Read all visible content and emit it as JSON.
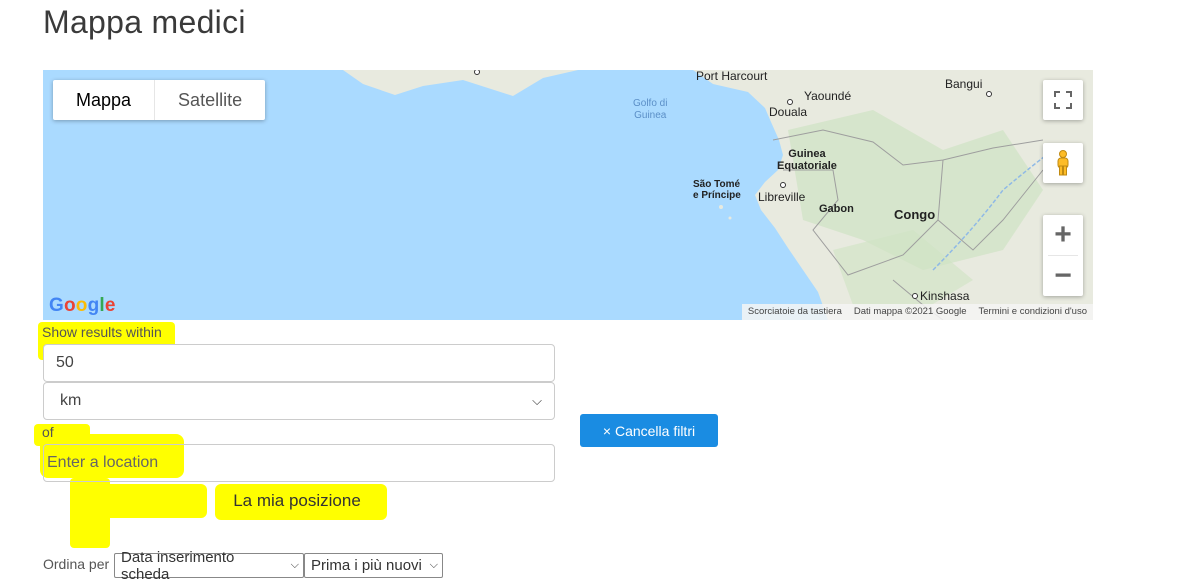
{
  "page": {
    "title": "Mappa medici"
  },
  "map": {
    "type_buttons": {
      "map": "Mappa",
      "satellite": "Satellite"
    },
    "labels": {
      "port_harcourt": "Port Harcourt",
      "yaounde": "Yaoundé",
      "bangui": "Bangui",
      "douala": "Douala",
      "golfo_1": "Golfo di",
      "golfo_2": "Guinea",
      "guinea_eq_1": "Guinea",
      "guinea_eq_2": "Equatoriale",
      "sao_tome_1": "São Tomé",
      "sao_tome_2": "e Príncipe",
      "libreville": "Libreville",
      "gabon": "Gabon",
      "congo": "Congo",
      "kinshasa": "Kinshasa"
    },
    "zoom_in": "+",
    "zoom_out": "−",
    "google_logo": "Google",
    "attribution": {
      "shortcuts": "Scorciatoie da tastiera",
      "data": "Dati mappa ©2021 Google",
      "terms": "Termini e condizioni d'uso"
    },
    "icons": {
      "fullscreen": "fullscreen-icon",
      "pegman": "pegman-icon"
    },
    "colors": {
      "water": "#aadaff",
      "land": "#e8eadf"
    }
  },
  "filters": {
    "within_label": "Show results within",
    "distance_value": "50",
    "unit_value": "km",
    "of_label": "of",
    "location_placeholder": "Enter a location",
    "my_position": "La mia posizione",
    "clear_filters": "× Cancella filtri"
  },
  "sort": {
    "label": "Ordina per",
    "field_value": "Data inserimento scheda",
    "order_value": "Prima i più nuovi"
  },
  "colors": {
    "accent": "#1a8ce2",
    "highlight": "#ffff00"
  }
}
